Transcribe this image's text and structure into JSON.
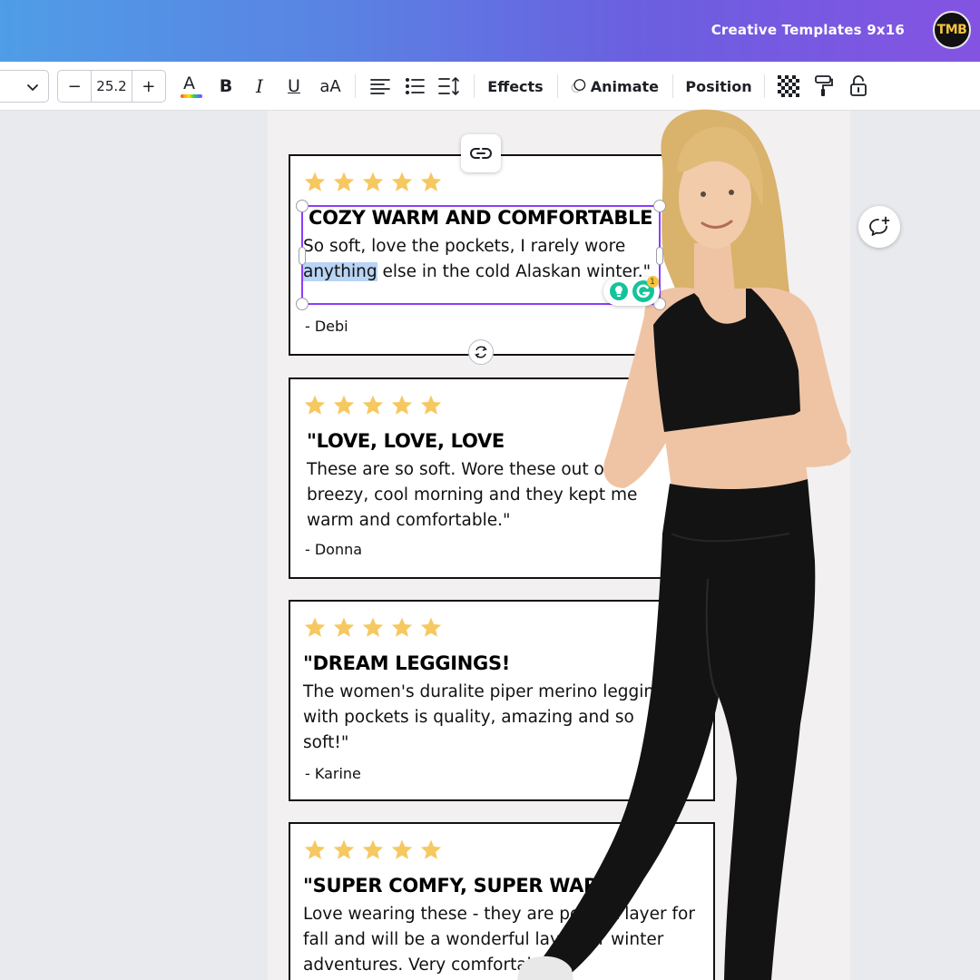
{
  "header": {
    "title": "Creative Templates 9x16",
    "avatar_initials": "TMB"
  },
  "toolbar": {
    "font_size": "25.2",
    "decrease_label": "−",
    "increase_label": "+",
    "text_color_glyph": "A",
    "bold_glyph": "B",
    "italic_glyph": "I",
    "underline_glyph": "U",
    "case_glyph": "aA",
    "effects_label": "Effects",
    "animate_label": "Animate",
    "position_label": "Position"
  },
  "reviews": [
    {
      "headline": "COZY WARM AND COMFORTABLE",
      "body_before": "So soft, love the pockets, I rarely wore ",
      "body_highlight": "anything",
      "body_after": " else in the cold Alaskan winter.\"",
      "author": "- Debi"
    },
    {
      "headline": "\"LOVE, LOVE, LOVE",
      "body": "These are so soft. Wore these out on a breezy, cool morning and they kept me warm and comfortable.\"",
      "author": "- Donna"
    },
    {
      "headline": "\"DREAM LEGGINGS!",
      "body": "The women's duralite piper merino legging with pockets is quality, amazing and so soft!\"",
      "author": "- Karine"
    },
    {
      "headline": "\"SUPER COMFY, SUPER WARM",
      "body": "Love wearing these - they are perfect layer for fall and will be a wonderful layer for winter adventures. Very comfortable!\""
    }
  ],
  "grammarly": {
    "badge_count": "1"
  },
  "colors": {
    "star": "#f6c860",
    "selection": "#8b3dff",
    "highlight": "#b9d4f4",
    "grammarly_green": "#15c39a"
  },
  "icons": [
    "chevron-down-icon",
    "text-color-icon",
    "align-left-icon",
    "bullet-list-icon",
    "line-spacing-icon",
    "animate-icon",
    "paint-roller-icon",
    "transparency-icon",
    "lock-icon",
    "link-icon",
    "rotate-icon",
    "add-comment-icon",
    "grammarly-icon"
  ]
}
